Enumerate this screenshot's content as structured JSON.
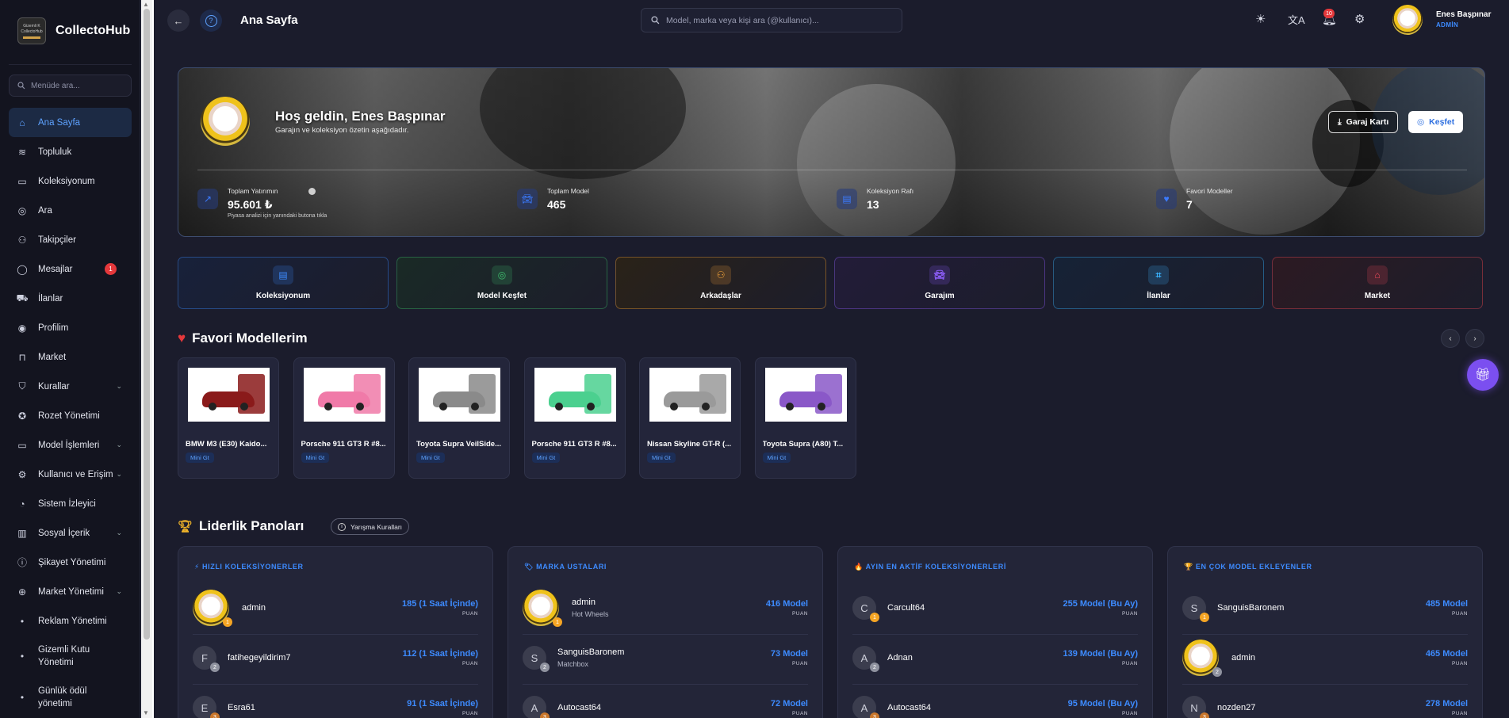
{
  "app": {
    "name": "CollectoHub",
    "logo_line1": "Gizemli K",
    "logo_line2": "CollectoHub"
  },
  "sidebar": {
    "search_placeholder": "Menüde ara...",
    "items": [
      {
        "label": "Ana Sayfa",
        "icon": "home-icon",
        "active": true
      },
      {
        "label": "Topluluk",
        "icon": "wifi-icon"
      },
      {
        "label": "Koleksiyonum",
        "icon": "briefcase-icon"
      },
      {
        "label": "Ara",
        "icon": "compass-icon"
      },
      {
        "label": "Takipçiler",
        "icon": "users-icon"
      },
      {
        "label": "Mesajlar",
        "icon": "chat-icon",
        "badge": "1"
      },
      {
        "label": "İlanlar",
        "icon": "cart-icon"
      },
      {
        "label": "Profilim",
        "icon": "user-circle-icon"
      },
      {
        "label": "Market",
        "icon": "bag-icon"
      },
      {
        "label": "Kurallar",
        "icon": "shield-icon",
        "chevron": true
      },
      {
        "label": "Rozet Yönetimi",
        "icon": "badge-icon"
      },
      {
        "label": "Model İşlemleri",
        "icon": "briefcase-icon",
        "chevron": true
      },
      {
        "label": "Kullanıcı ve Erişim",
        "icon": "gear-icon",
        "chevron": true
      },
      {
        "label": "Sistem İzleyici",
        "icon": "gauge-icon"
      },
      {
        "label": "Sosyal İçerik",
        "icon": "book-icon",
        "chevron": true
      },
      {
        "label": "Şikayet Yönetimi",
        "icon": "alert-icon"
      },
      {
        "label": "Market Yönetimi",
        "icon": "plus-circle-icon",
        "chevron": true
      },
      {
        "label": "Reklam Yönetimi",
        "icon": "dot-icon"
      },
      {
        "label": "Gizemli Kutu Yönetimi",
        "icon": "dot-icon"
      },
      {
        "label": "Günlük ödül yönetimi",
        "icon": "dot-icon"
      }
    ]
  },
  "header": {
    "title": "Ana Sayfa",
    "search_placeholder": "Model, marka veya kişi ara (@kullanıcı)...",
    "notification_count": "10",
    "user_name": "Enes Başpınar",
    "user_role": "ADMİN"
  },
  "hero": {
    "welcome": "Hoş geldin, Enes Başpınar",
    "subtitle": "Garajın ve koleksiyon özetin aşağıdadır.",
    "btn_garage": "Garaj Kartı",
    "btn_explore": "Keşfet",
    "stats": [
      {
        "label": "Toplam Yatırımın",
        "value": "95.601 ₺",
        "note": "Piyasa analizi için yanındaki butona tıkla"
      },
      {
        "label": "Toplam Model",
        "value": "465"
      },
      {
        "label": "Koleksiyon Rafı",
        "value": "13"
      },
      {
        "label": "Favori Modeller",
        "value": "7"
      }
    ]
  },
  "quick_links": [
    {
      "label": "Koleksiyonum",
      "color": "#3d8bff"
    },
    {
      "label": "Model Keşfet",
      "color": "#3fbf6f"
    },
    {
      "label": "Arkadaşlar",
      "color": "#f0a13a"
    },
    {
      "label": "Garajım",
      "color": "#8b5cf6"
    },
    {
      "label": "İlanlar",
      "color": "#3ab4ff"
    },
    {
      "label": "Market",
      "color": "#f04a5a"
    }
  ],
  "favorites": {
    "title": "Favori Modellerim",
    "items": [
      {
        "name": "BMW M3 (E30) Kaido...",
        "tag": "Mini Gt",
        "color": "#8a1a1a"
      },
      {
        "name": "Porsche 911 GT3 R #8...",
        "tag": "Mini Gt",
        "color": "#f07aa8"
      },
      {
        "name": "Toyota Supra VeilSide...",
        "tag": "Mini Gt",
        "color": "#8a8a8a"
      },
      {
        "name": "Porsche 911 GT3 R #8...",
        "tag": "Mini Gt",
        "color": "#4bd08f"
      },
      {
        "name": "Nissan Skyline GT-R (...",
        "tag": "Mini Gt",
        "color": "#9a9a9a"
      },
      {
        "name": "Toyota Supra (A80) T...",
        "tag": "Mini Gt",
        "color": "#8a58c8"
      }
    ]
  },
  "leaderboards": {
    "title": "Liderlik Panoları",
    "rules_label": "Yarışma Kuralları",
    "points_label": "PUAN",
    "boards": [
      {
        "title": "HIZLI KOLEKSİYONERLER",
        "icon": "⚡",
        "rows": [
          {
            "name": "admin",
            "sub": "",
            "value": "185 (1 Saat İçinde)",
            "letter": "",
            "rank": "1"
          },
          {
            "name": "fatihegeyildirim7",
            "sub": "",
            "value": "112 (1 Saat İçinde)",
            "letter": "F",
            "rank": "2"
          },
          {
            "name": "Esra61",
            "sub": "",
            "value": "91 (1 Saat İçinde)",
            "letter": "E",
            "rank": "3"
          }
        ]
      },
      {
        "title": "MARKA USTALARI",
        "icon": "🏷",
        "rows": [
          {
            "name": "admin",
            "sub": "Hot Wheels",
            "value": "416 Model",
            "letter": "",
            "rank": "1"
          },
          {
            "name": "SanguisBaronem",
            "sub": "Matchbox",
            "value": "73 Model",
            "letter": "S",
            "rank": "2"
          },
          {
            "name": "Autocast64",
            "sub": "",
            "value": "72 Model",
            "letter": "A",
            "rank": "3"
          }
        ]
      },
      {
        "title": "AYIN EN AKTİF KOLEKSİYONERLERİ",
        "icon": "🔥",
        "rows": [
          {
            "name": "Carcult64",
            "sub": "",
            "value": "255 Model (Bu Ay)",
            "letter": "C",
            "rank": "1"
          },
          {
            "name": "Adnan",
            "sub": "",
            "value": "139 Model (Bu Ay)",
            "letter": "A",
            "rank": "2"
          },
          {
            "name": "Autocast64",
            "sub": "",
            "value": "95 Model (Bu Ay)",
            "letter": "A",
            "rank": "3"
          }
        ]
      },
      {
        "title": "EN ÇOK MODEL EKLEYENLER",
        "icon": "🏆",
        "rows": [
          {
            "name": "SanguisBaronem",
            "sub": "",
            "value": "485 Model",
            "letter": "S",
            "rank": "1"
          },
          {
            "name": "admin",
            "sub": "",
            "value": "465 Model",
            "letter": "",
            "rank": "2"
          },
          {
            "name": "nozden27",
            "sub": "",
            "value": "278 Model",
            "letter": "N",
            "rank": "3"
          }
        ]
      }
    ]
  }
}
